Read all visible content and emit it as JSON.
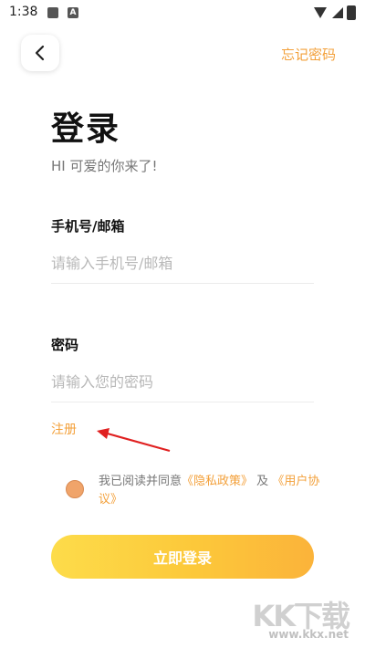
{
  "status_bar": {
    "time": "1:38",
    "icons": [
      "image-icon",
      "a-icon",
      "wifi-icon",
      "signal-icon",
      "battery-icon"
    ]
  },
  "header": {
    "back_icon": "chevron-left-icon",
    "forgot_password": "忘记密码"
  },
  "title": "登录",
  "subtitle": "HI 可爱的你来了!",
  "phone": {
    "label": "手机号/邮箱",
    "placeholder": "请输入手机号/邮箱",
    "value": ""
  },
  "password": {
    "label": "密码",
    "placeholder": "请输入您的密码",
    "value": ""
  },
  "register": "注册",
  "agreement": {
    "prefix": "我已阅读并同意",
    "privacy": "《隐私政策》",
    "and": "及",
    "user_agreement": "《用户协议》"
  },
  "login_button": "立即登录",
  "watermark": {
    "logo": "KK下载",
    "url": "www.kkx.net"
  },
  "colors": {
    "accent": "#f3a03a",
    "button_start": "#fddc4a",
    "button_end": "#fbb33a",
    "arrow": "#e02020"
  }
}
